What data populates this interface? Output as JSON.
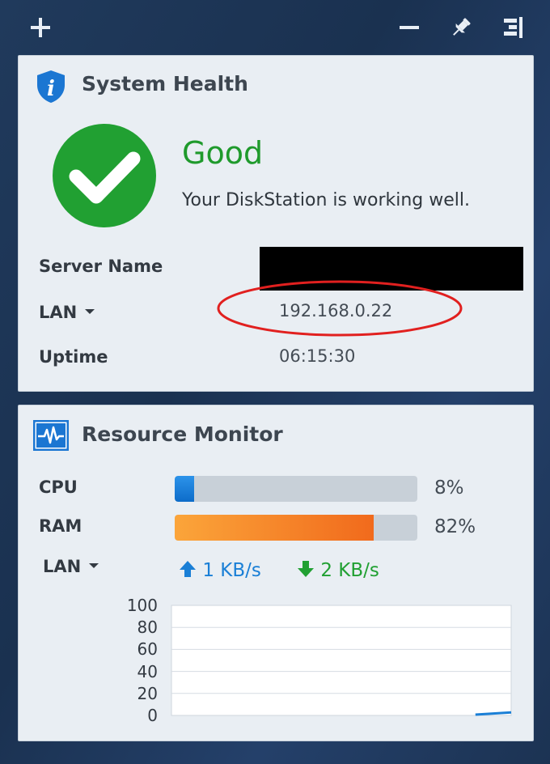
{
  "topbar": {
    "add_icon": "plus-icon",
    "minimize_icon": "minus-icon",
    "pin_icon": "pin-icon",
    "layout_icon": "panel-toggle-icon"
  },
  "system_health": {
    "title": "System Health",
    "status": "Good",
    "message": "Your DiskStation is working well.",
    "status_color": "#1f9a2c",
    "rows": [
      {
        "label": "Server Name",
        "value": ""
      },
      {
        "label": "LAN",
        "value": "192.168.0.22"
      },
      {
        "label": "Uptime",
        "value": "06:15:30"
      }
    ]
  },
  "resource_monitor": {
    "title": "Resource Monitor",
    "cpu": {
      "label": "CPU",
      "percent": 8,
      "text": "8%"
    },
    "ram": {
      "label": "RAM",
      "percent": 82,
      "text": "82%"
    },
    "lan": {
      "label": "LAN",
      "upload": "1 KB/s",
      "download": "2 KB/s"
    },
    "accent": "#1a7fd6",
    "ram_color": "#f47a1f"
  },
  "chart_data": {
    "type": "area",
    "y_ticks": [
      "100",
      "80",
      "60",
      "40",
      "20",
      "0"
    ],
    "ylim": [
      0,
      100
    ],
    "x": [
      0,
      1,
      2,
      3,
      4,
      5,
      6,
      7,
      8,
      9,
      10,
      11,
      12,
      13,
      14,
      15,
      16,
      17,
      18,
      19
    ],
    "series": [
      {
        "values": [
          0,
          0,
          0,
          0,
          0,
          0,
          0,
          0,
          0,
          0,
          0,
          0,
          0,
          0,
          0,
          0,
          0,
          0,
          1,
          2
        ]
      }
    ]
  }
}
